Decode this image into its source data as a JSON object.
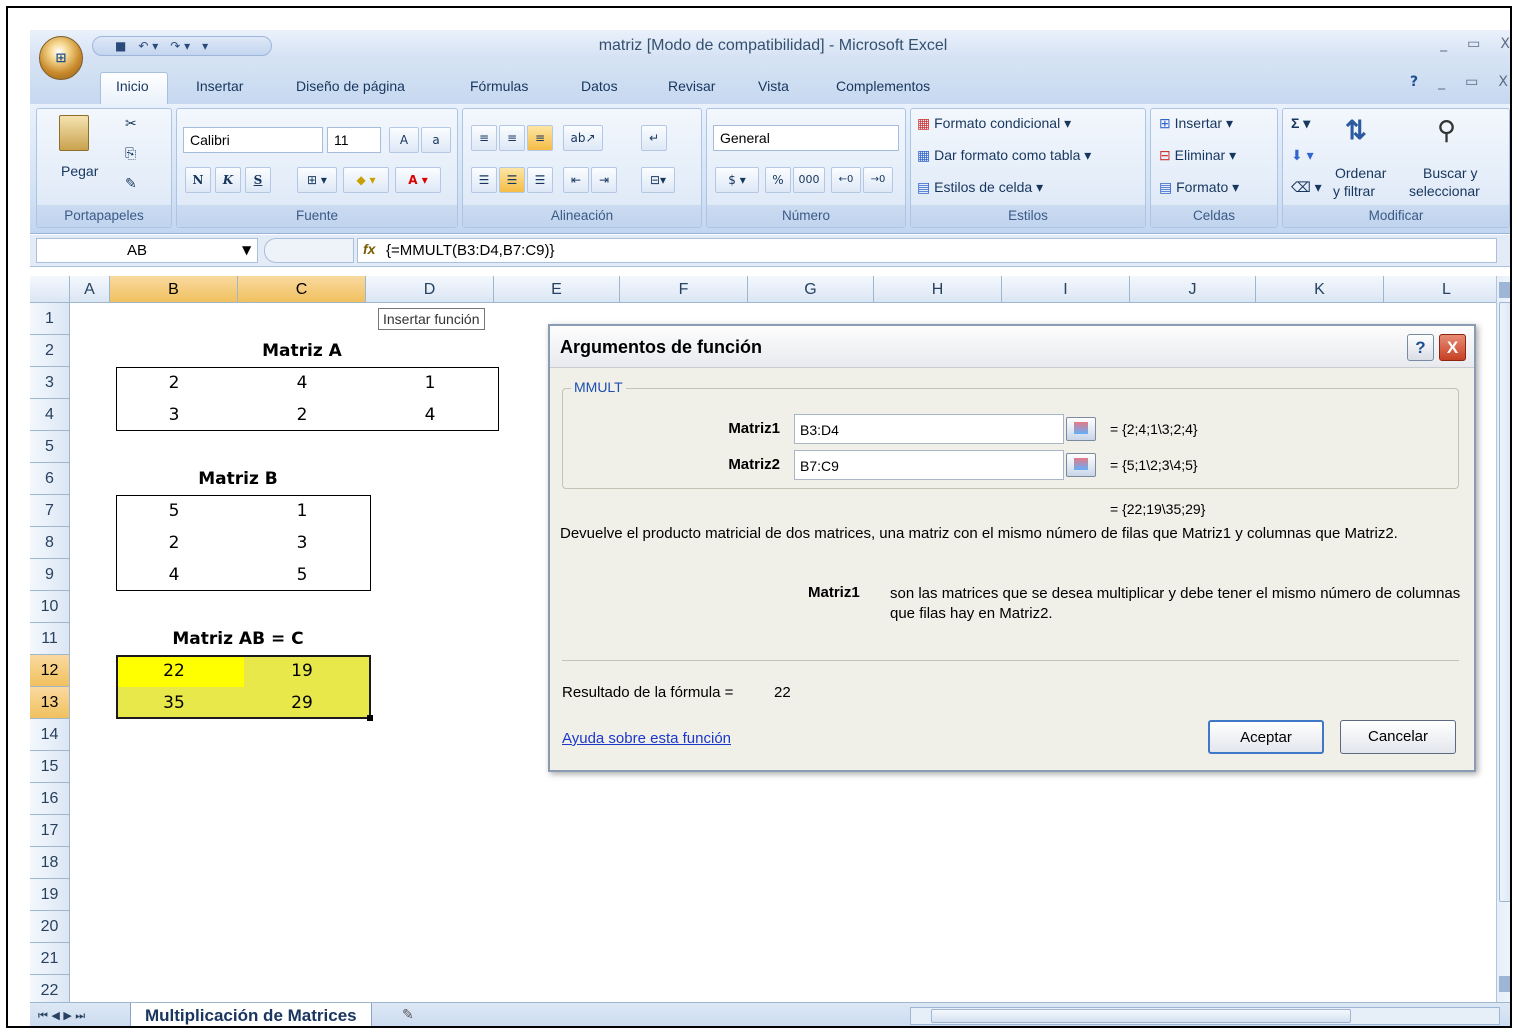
{
  "window": {
    "title": "matriz  [Modo de compatibilidad] - Microsoft Excel",
    "office_button_text": "",
    "controls": [
      "_",
      "▭",
      "X"
    ],
    "tab_controls": [
      "?",
      "_",
      "▭",
      "X"
    ]
  },
  "ribbon_tabs": [
    "Inicio",
    "Insertar",
    "Diseño de página",
    "Fórmulas",
    "Datos",
    "Revisar",
    "Vista",
    "Complementos"
  ],
  "ribbon": {
    "clipboard": {
      "title": "Portapapeles",
      "paste": "Pegar"
    },
    "font": {
      "title": "Fuente",
      "font_name": "Calibri",
      "font_size": "11",
      "bold": "N",
      "italic": "K",
      "underline": "S"
    },
    "alignment": {
      "title": "Alineación"
    },
    "number": {
      "title": "Número",
      "format": "General",
      "percent": "%",
      "thousands": "000"
    },
    "styles": {
      "title": "Estilos",
      "conditional": "Formato condicional",
      "as_table": "Dar formato como tabla",
      "cell_styles": "Estilos de celda"
    },
    "cells": {
      "title": "Celdas",
      "insert": "Insertar",
      "delete": "Eliminar",
      "format": "Formato"
    },
    "edit": {
      "title": "Modificar",
      "sort_1": "Ordenar",
      "sort_2": "y filtrar",
      "find_1": "Buscar y",
      "find_2": "seleccionar",
      "sigma": "Σ"
    }
  },
  "formula_bar": {
    "name_box": "AB",
    "fx": "fx",
    "formula": "{=MMULT(B3:D4,B7:C9)}"
  },
  "tooltip": "Insertar función",
  "columns": [
    "A",
    "B",
    "C",
    "D",
    "E",
    "F",
    "G",
    "H",
    "I",
    "J",
    "K",
    "L"
  ],
  "rows": [
    "1",
    "2",
    "3",
    "4",
    "5",
    "6",
    "7",
    "8",
    "9",
    "10",
    "11",
    "12",
    "13",
    "14",
    "15",
    "16",
    "17",
    "18",
    "19",
    "20",
    "21",
    "22"
  ],
  "sheet": {
    "matrix_a_title": "Matriz A",
    "matrix_a": [
      [
        "2",
        "4",
        "1"
      ],
      [
        "3",
        "2",
        "4"
      ]
    ],
    "matrix_b_title": "Matriz B",
    "matrix_b": [
      [
        "5",
        "1"
      ],
      [
        "2",
        "3"
      ],
      [
        "4",
        "5"
      ]
    ],
    "matrix_ab_title": "Matriz AB = C",
    "matrix_ab": [
      [
        "22",
        "19"
      ],
      [
        "35",
        "29"
      ]
    ],
    "highlight_color": "#e8e84a"
  },
  "sheet_tab": "Multiplicación de Matrices",
  "dialog": {
    "title": "Argumentos de función",
    "help_btn": "?",
    "close_btn": "X",
    "function_name": "MMULT",
    "arg1_label": "Matriz1",
    "arg1_value": "B3:D4",
    "arg1_result": "=  {2;4;1\\3;2;4}",
    "arg2_label": "Matriz2",
    "arg2_value": "B7:C9",
    "arg2_result": "=  {5;1\\2;3\\4;5}",
    "total_result": "=  {22;19\\35;29}",
    "description": "Devuelve el producto matricial de dos matrices, una matriz con el mismo número de filas que Matriz1 y columnas que Matriz2.",
    "param_name": "Matriz1",
    "param_desc": "son las matrices que se desea multiplicar y debe tener el mismo número de columnas que filas hay en Matriz2.",
    "formula_result_label": "Resultado de la fórmula =",
    "formula_result_value": "22",
    "help_link": "Ayuda sobre esta función",
    "ok": "Aceptar",
    "cancel": "Cancelar"
  }
}
